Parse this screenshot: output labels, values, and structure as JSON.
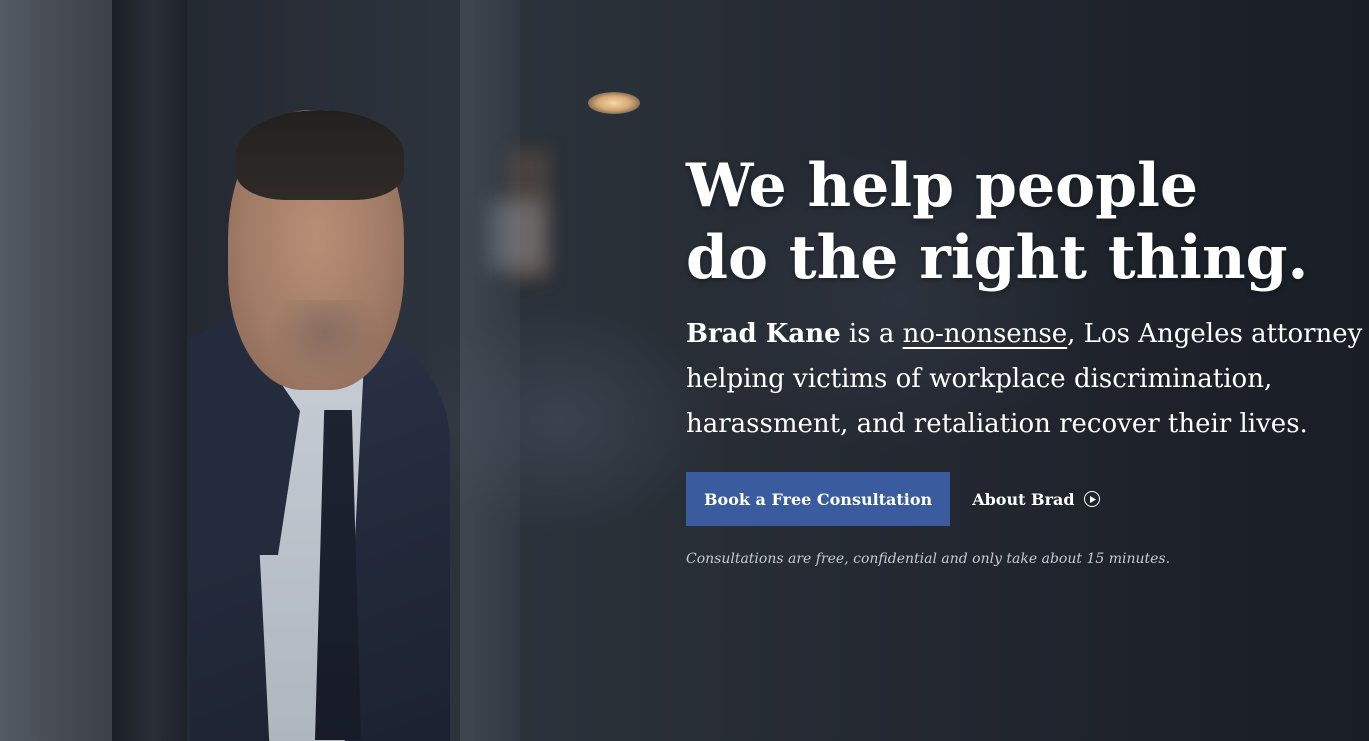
{
  "hero": {
    "headline_line1": "We help people",
    "headline_line2": "do the right thing.",
    "intro": {
      "name": "Brad Kane",
      "text_before_link": "is a",
      "link_text": "no-nonsense",
      "text_after_link": ", Los Angeles attorney",
      "line2": "helping victims of workplace discrimination,",
      "line3": "harassment, and retaliation recover their lives."
    },
    "primary_button_label": "Book a Free Consultation",
    "secondary_link_label": "About Brad",
    "secondary_link_icon": "play-circle-icon",
    "note": "Consultations are free, confidential and only take about 15 minutes."
  },
  "colors": {
    "button_blue": "#3a5c9f",
    "text_white": "#ffffff",
    "note_gray": "#c6cbd2",
    "background_dark": "#1c2029"
  }
}
